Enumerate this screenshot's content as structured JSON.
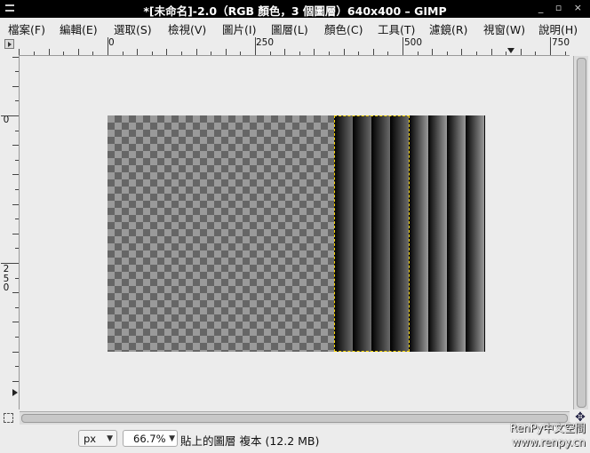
{
  "window": {
    "title": "*[未命名]-2.0（RGB 顏色，3 個圖層）640x400 – GIMP",
    "controls": "_ ▫ ×"
  },
  "menu": [
    {
      "label": "檔案(F)"
    },
    {
      "label": "編輯(E)"
    },
    {
      "label": "選取(S)"
    },
    {
      "label": "檢視(V)"
    },
    {
      "label": "圖片(I)"
    },
    {
      "label": "圖層(L)"
    },
    {
      "label": "顏色(C)"
    },
    {
      "label": "工具(T)"
    },
    {
      "label": "濾鏡(R)"
    },
    {
      "label": "視窗(W)"
    },
    {
      "label": "說明(H)"
    }
  ],
  "rulers": {
    "horizontal_labels": [
      "0",
      "250",
      "500",
      "750"
    ],
    "vertical_labels": [
      "0",
      "2\n5\n0"
    ]
  },
  "image": {
    "width": 640,
    "height": 400,
    "layers": 3
  },
  "status": {
    "unit": "px",
    "zoom": "66.7%",
    "message": "貼上的圖層 複本 (12.2 MB)"
  },
  "watermark": {
    "line1": "RenPy中文空間",
    "line2": "www.renpy.cn"
  }
}
